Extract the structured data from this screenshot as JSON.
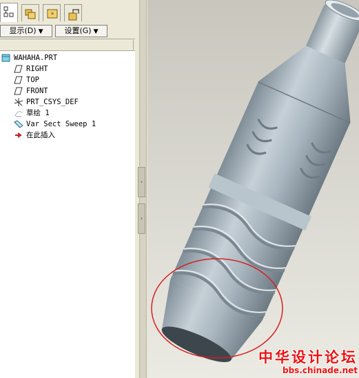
{
  "tabs": [
    {
      "name": "model-tree",
      "icon": "model-tree-icon",
      "active": true
    },
    {
      "name": "folder-browser",
      "icon": "folder-browser-icon",
      "active": false
    },
    {
      "name": "favorites",
      "icon": "favorites-icon",
      "active": false
    },
    {
      "name": "connections",
      "icon": "connections-icon",
      "active": false
    }
  ],
  "toolbar": {
    "display_label": "显示(D)",
    "settings_label": "设置(G)"
  },
  "tree": {
    "items": [
      {
        "label": "WAHAHA.PRT",
        "icon": "part-icon"
      },
      {
        "label": "RIGHT",
        "icon": "datum-plane-icon"
      },
      {
        "label": "TOP",
        "icon": "datum-plane-icon"
      },
      {
        "label": "FRONT",
        "icon": "datum-plane-icon"
      },
      {
        "label": "PRT_CSYS_DEF",
        "icon": "coordinate-system-icon"
      },
      {
        "label": "草绘 1",
        "icon": "sketch-icon"
      },
      {
        "label": "Var Sect Sweep 1",
        "icon": "sweep-icon"
      },
      {
        "label": "在此插入",
        "icon": "insert-here-arrow-icon"
      }
    ]
  },
  "watermark": {
    "title": "中华设计论坛",
    "url": "bbs.chinade.net"
  },
  "colors": {
    "panel_bg": "#ece9d8",
    "viewport_bg_top": "#c8c6bd",
    "viewport_bg_bottom": "#ebeae3",
    "model_color": "#a9b6bf",
    "highlight_circle": "#d61f1f",
    "watermark_text": "#ee1111"
  }
}
